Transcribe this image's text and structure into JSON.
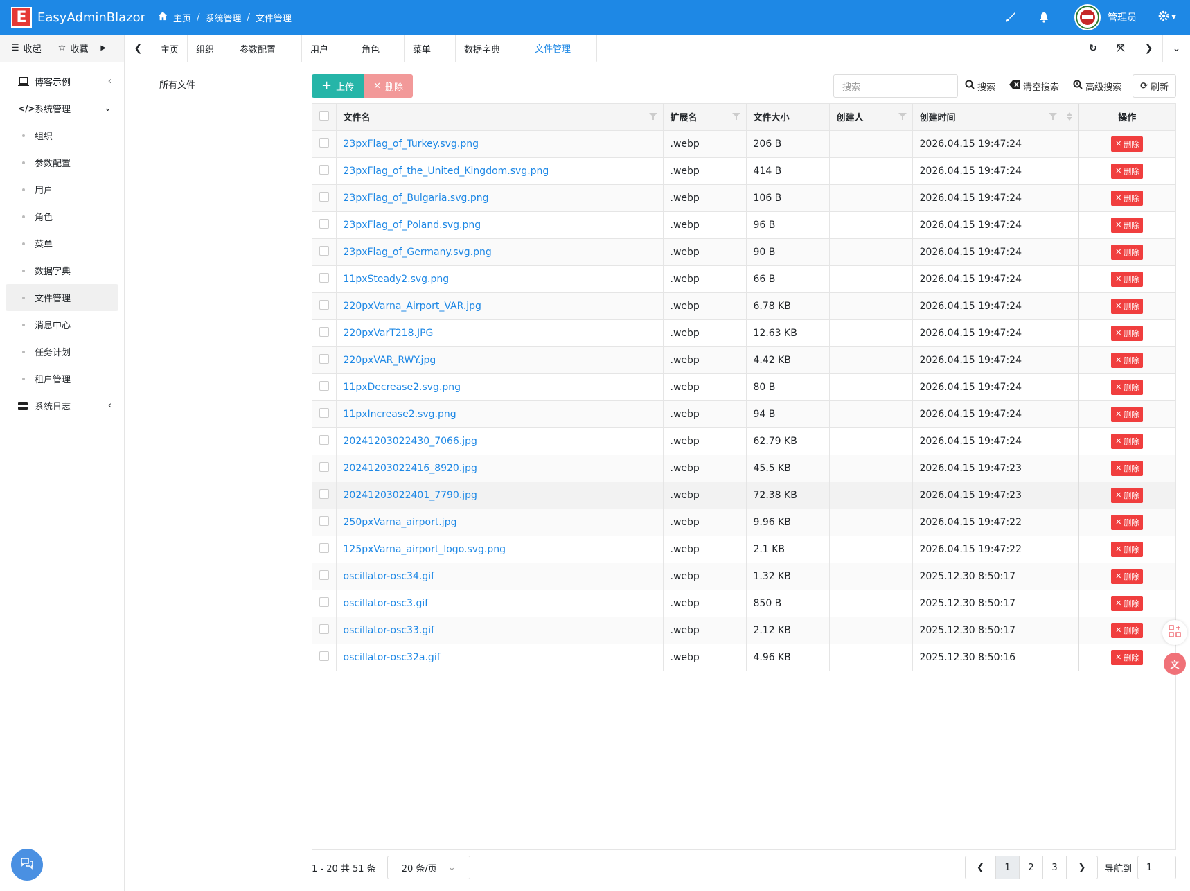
{
  "header": {
    "logo_letter": "E",
    "app_name": "EasyAdminBlazor",
    "breadcrumb": [
      "主页",
      "系统管理",
      "文件管理"
    ],
    "user_name": "管理员"
  },
  "sidebar": {
    "collapse_label": "收起",
    "favorites_label": "收藏",
    "menu": [
      {
        "label": "博客示例",
        "icon": "laptop-icon"
      },
      {
        "label": "系统管理",
        "icon": "code-icon"
      },
      {
        "label": "组织"
      },
      {
        "label": "参数配置"
      },
      {
        "label": "用户"
      },
      {
        "label": "角色"
      },
      {
        "label": "菜单"
      },
      {
        "label": "数据字典"
      },
      {
        "label": "文件管理"
      },
      {
        "label": "消息中心"
      },
      {
        "label": "任务计划"
      },
      {
        "label": "租户管理"
      },
      {
        "label": "系统日志",
        "icon": "server-icon"
      }
    ]
  },
  "tabs": [
    "主页",
    "组织",
    "参数配置",
    "用户",
    "角色",
    "菜单",
    "数据字典",
    "文件管理"
  ],
  "tree": {
    "root": "所有文件"
  },
  "toolbar": {
    "upload": "上传",
    "delete": "删除",
    "search_placeholder": "搜索",
    "search": "搜索",
    "clear_search": "清空搜索",
    "advanced_search": "高级搜索",
    "refresh": "刷新"
  },
  "table": {
    "columns": [
      "文件名",
      "扩展名",
      "文件大小",
      "创建人",
      "创建时间",
      "操作"
    ],
    "delete_label": "删除",
    "rows": [
      {
        "name": "23pxFlag_of_Turkey.svg.png",
        "ext": ".webp",
        "size": "206 B",
        "creator": "",
        "time": "2026.04.15 19:47:24"
      },
      {
        "name": "23pxFlag_of_the_United_Kingdom.svg.png",
        "ext": ".webp",
        "size": "414 B",
        "creator": "",
        "time": "2026.04.15 19:47:24"
      },
      {
        "name": "23pxFlag_of_Bulgaria.svg.png",
        "ext": ".webp",
        "size": "106 B",
        "creator": "",
        "time": "2026.04.15 19:47:24"
      },
      {
        "name": "23pxFlag_of_Poland.svg.png",
        "ext": ".webp",
        "size": "96 B",
        "creator": "",
        "time": "2026.04.15 19:47:24"
      },
      {
        "name": "23pxFlag_of_Germany.svg.png",
        "ext": ".webp",
        "size": "90 B",
        "creator": "",
        "time": "2026.04.15 19:47:24"
      },
      {
        "name": "11pxSteady2.svg.png",
        "ext": ".webp",
        "size": "66 B",
        "creator": "",
        "time": "2026.04.15 19:47:24"
      },
      {
        "name": "220pxVarna_Airport_VAR.jpg",
        "ext": ".webp",
        "size": "6.78 KB",
        "creator": "",
        "time": "2026.04.15 19:47:24"
      },
      {
        "name": "220pxVarT218.JPG",
        "ext": ".webp",
        "size": "12.63 KB",
        "creator": "",
        "time": "2026.04.15 19:47:24"
      },
      {
        "name": "220pxVAR_RWY.jpg",
        "ext": ".webp",
        "size": "4.42 KB",
        "creator": "",
        "time": "2026.04.15 19:47:24"
      },
      {
        "name": "11pxDecrease2.svg.png",
        "ext": ".webp",
        "size": "80 B",
        "creator": "",
        "time": "2026.04.15 19:47:24"
      },
      {
        "name": "11pxIncrease2.svg.png",
        "ext": ".webp",
        "size": "94 B",
        "creator": "",
        "time": "2026.04.15 19:47:24"
      },
      {
        "name": "20241203022430_7066.jpg",
        "ext": ".webp",
        "size": "62.79 KB",
        "creator": "",
        "time": "2026.04.15 19:47:24"
      },
      {
        "name": "20241203022416_8920.jpg",
        "ext": ".webp",
        "size": "45.5 KB",
        "creator": "",
        "time": "2026.04.15 19:47:23"
      },
      {
        "name": "20241203022401_7790.jpg",
        "ext": ".webp",
        "size": "72.38 KB",
        "creator": "",
        "time": "2026.04.15 19:47:23"
      },
      {
        "name": "250pxVarna_airport.jpg",
        "ext": ".webp",
        "size": "9.96 KB",
        "creator": "",
        "time": "2026.04.15 19:47:22"
      },
      {
        "name": "125pxVarna_airport_logo.svg.png",
        "ext": ".webp",
        "size": "2.1 KB",
        "creator": "",
        "time": "2026.04.15 19:47:22"
      },
      {
        "name": "oscillator-osc34.gif",
        "ext": ".webp",
        "size": "1.32 KB",
        "creator": "",
        "time": "2025.12.30 8:50:17"
      },
      {
        "name": "oscillator-osc3.gif",
        "ext": ".webp",
        "size": "850 B",
        "creator": "",
        "time": "2025.12.30 8:50:17"
      },
      {
        "name": "oscillator-osc33.gif",
        "ext": ".webp",
        "size": "2.12 KB",
        "creator": "",
        "time": "2025.12.30 8:50:17"
      },
      {
        "name": "oscillator-osc32a.gif",
        "ext": ".webp",
        "size": "4.96 KB",
        "creator": "",
        "time": "2025.12.30 8:50:16"
      }
    ]
  },
  "pagination": {
    "summary": "1 - 20 共 51 条",
    "page_size": "20 条/页",
    "pages": [
      "1",
      "2",
      "3"
    ],
    "current": "1",
    "goto_label": "导航到",
    "goto_value": "1"
  },
  "colors": {
    "primary": "#1e88e5",
    "upload": "#26b5a8",
    "delete_light": "#f29999",
    "danger": "#f03e3e"
  }
}
